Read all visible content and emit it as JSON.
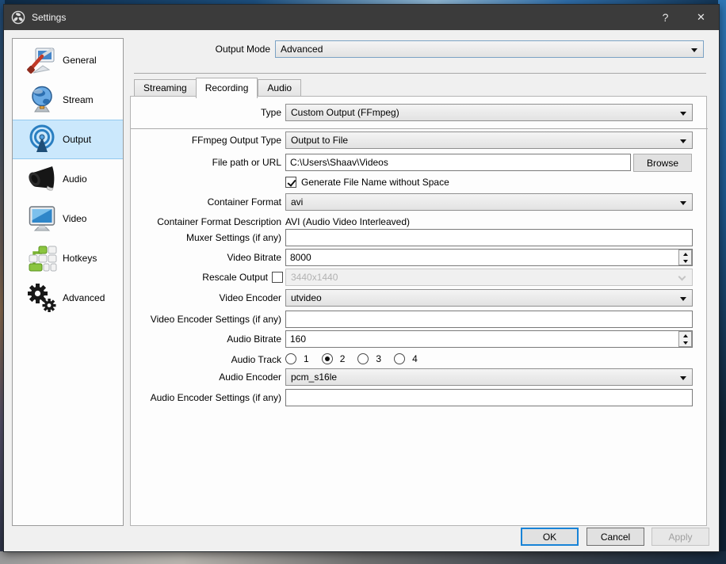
{
  "window": {
    "title": "Settings",
    "help_glyph": "?",
    "close_glyph": "✕"
  },
  "sidebar": {
    "items": [
      {
        "label": "General"
      },
      {
        "label": "Stream"
      },
      {
        "label": "Output",
        "selected": true
      },
      {
        "label": "Audio"
      },
      {
        "label": "Video"
      },
      {
        "label": "Hotkeys"
      },
      {
        "label": "Advanced"
      }
    ]
  },
  "output_mode": {
    "label": "Output Mode",
    "value": "Advanced"
  },
  "tabs": [
    {
      "label": "Streaming",
      "active": false
    },
    {
      "label": "Recording",
      "active": true
    },
    {
      "label": "Audio",
      "active": false
    }
  ],
  "form": {
    "type": {
      "label": "Type",
      "value": "Custom Output (FFmpeg)"
    },
    "ffmpeg_output_type": {
      "label": "FFmpeg Output Type",
      "value": "Output to File"
    },
    "file_path": {
      "label": "File path or URL",
      "value": "C:\\Users\\Shaav\\Videos",
      "browse_label": "Browse"
    },
    "generate_no_space": {
      "label": "Generate File Name without Space",
      "checked": true
    },
    "container_format": {
      "label": "Container Format",
      "value": "avi"
    },
    "container_format_description": {
      "label": "Container Format Description",
      "value": "AVI (Audio Video Interleaved)"
    },
    "muxer_settings": {
      "label": "Muxer Settings (if any)",
      "value": ""
    },
    "video_bitrate": {
      "label": "Video Bitrate",
      "value": "8000"
    },
    "rescale_output": {
      "label": "Rescale Output",
      "checked": false,
      "value": "3440x1440"
    },
    "video_encoder": {
      "label": "Video Encoder",
      "value": "utvideo"
    },
    "video_encoder_settings": {
      "label": "Video Encoder Settings (if any)",
      "value": ""
    },
    "audio_bitrate": {
      "label": "Audio Bitrate",
      "value": "160"
    },
    "audio_track": {
      "label": "Audio Track",
      "options": [
        "1",
        "2",
        "3",
        "4"
      ],
      "selected": "2"
    },
    "audio_encoder": {
      "label": "Audio Encoder",
      "value": "pcm_s16le"
    },
    "audio_encoder_settings": {
      "label": "Audio Encoder Settings (if any)",
      "value": ""
    }
  },
  "footer": {
    "ok": "OK",
    "cancel": "Cancel",
    "apply": "Apply"
  },
  "colors": {
    "titlebar": "#3b3b3b",
    "selection_highlight": "#cbe8fc",
    "ok_focus_border": "#1883d7",
    "dialog_background": "#f0f0f0"
  }
}
